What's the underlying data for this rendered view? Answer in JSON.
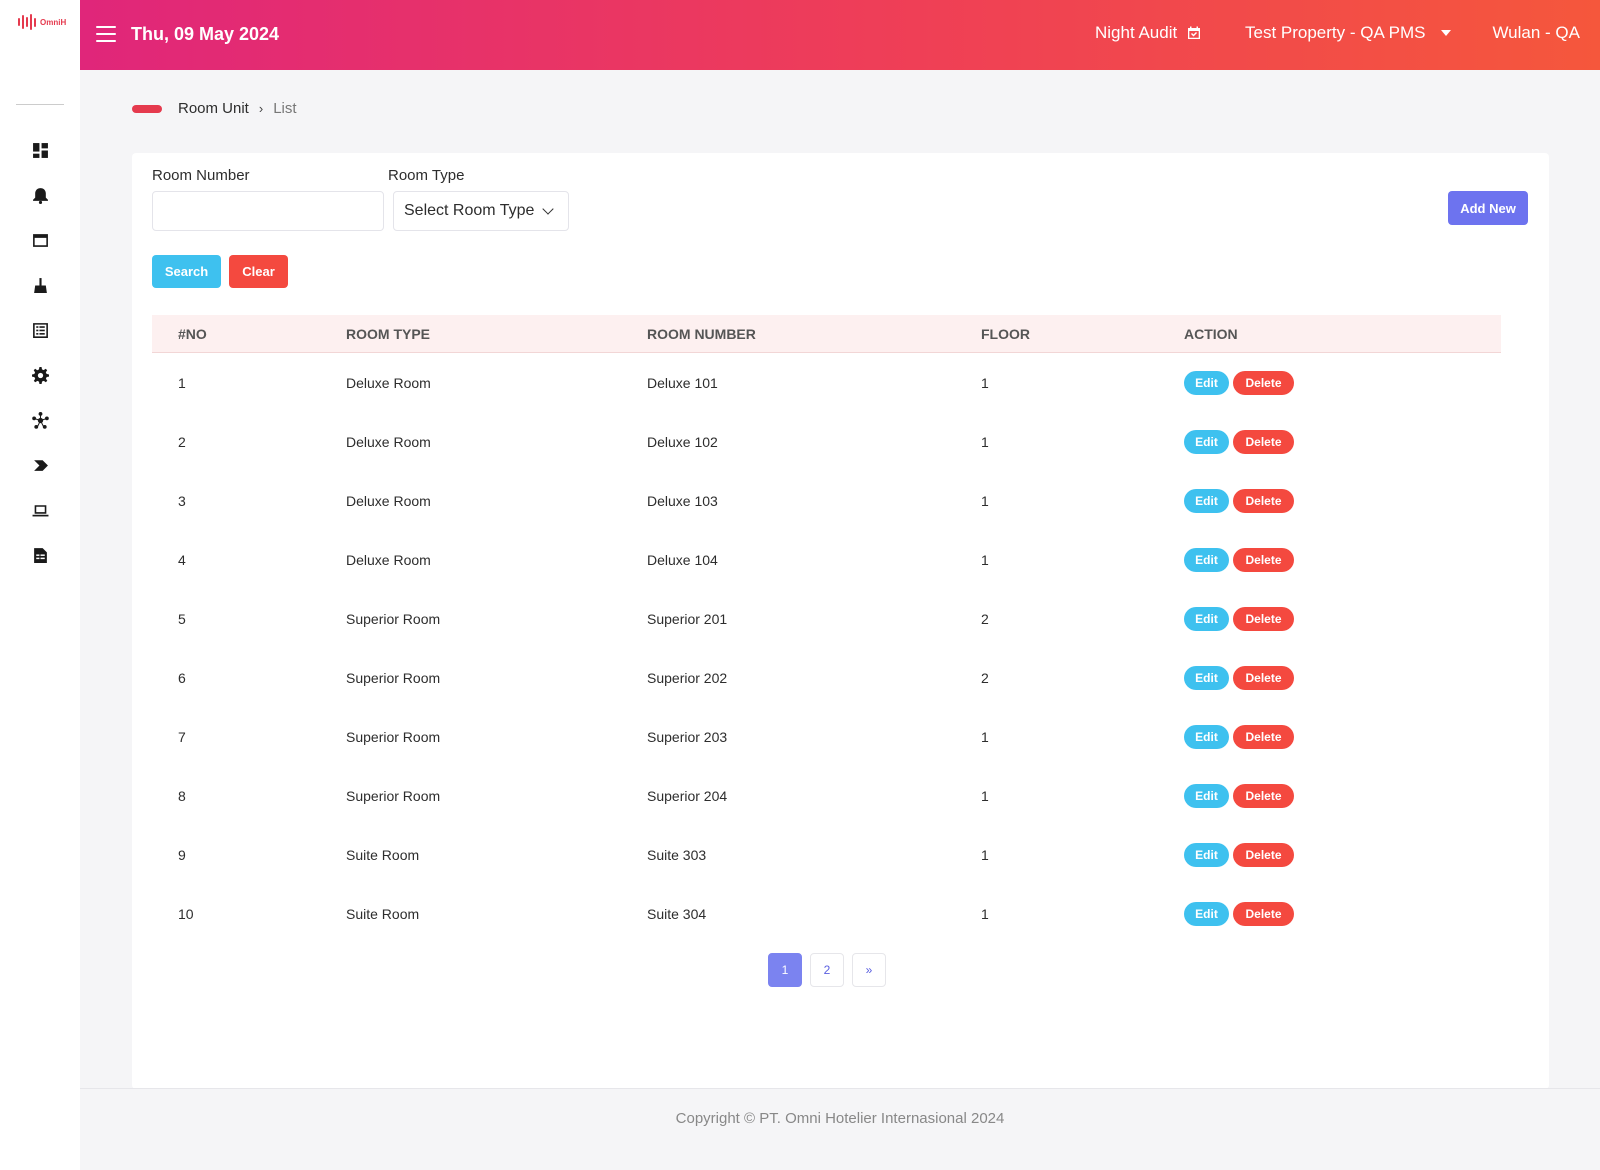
{
  "app": {
    "logo_text": "OmniH",
    "date": "Thu, 09 May 2024",
    "night_audit_label": "Night Audit",
    "property_label": "Test Property - QA PMS",
    "user_label": "Wulan - QA",
    "brand_color": "#e53a4e"
  },
  "sidebar": {
    "icons": [
      "dashboard-icon",
      "bell-icon",
      "window-icon",
      "broom-icon",
      "list-icon",
      "gear-icon",
      "network-icon",
      "tag-icon",
      "laptop-icon",
      "report-icon"
    ]
  },
  "breadcrumb": {
    "parent": "Room Unit",
    "separator": "›",
    "current": "List"
  },
  "filters": {
    "room_number_label": "Room Number",
    "room_number_value": "",
    "room_type_label": "Room Type",
    "room_type_selected": "Select Room Type",
    "add_new_label": "Add New",
    "search_label": "Search",
    "clear_label": "Clear"
  },
  "table": {
    "headers": [
      "#NO",
      "ROOM TYPE",
      "ROOM NUMBER",
      "FLOOR",
      "ACTION"
    ],
    "edit_label": "Edit",
    "delete_label": "Delete",
    "rows": [
      {
        "no": "1",
        "type": "Deluxe Room",
        "number": "Deluxe 101",
        "floor": "1"
      },
      {
        "no": "2",
        "type": "Deluxe Room",
        "number": "Deluxe 102",
        "floor": "1"
      },
      {
        "no": "3",
        "type": "Deluxe Room",
        "number": "Deluxe 103",
        "floor": "1"
      },
      {
        "no": "4",
        "type": "Deluxe Room",
        "number": "Deluxe 104",
        "floor": "1"
      },
      {
        "no": "5",
        "type": "Superior Room",
        "number": "Superior 201",
        "floor": "2"
      },
      {
        "no": "6",
        "type": "Superior Room",
        "number": "Superior 202",
        "floor": "2"
      },
      {
        "no": "7",
        "type": "Superior Room",
        "number": "Superior 203",
        "floor": "1"
      },
      {
        "no": "8",
        "type": "Superior Room",
        "number": "Superior 204",
        "floor": "1"
      },
      {
        "no": "9",
        "type": "Suite Room",
        "number": "Suite 303",
        "floor": "1"
      },
      {
        "no": "10",
        "type": "Suite Room",
        "number": "Suite 304",
        "floor": "1"
      }
    ]
  },
  "pagination": {
    "pages": [
      "1",
      "2"
    ],
    "active": "1",
    "next_label": "»"
  },
  "footer": {
    "copyright": "Copyright © PT. Omni Hotelier Internasional 2024"
  }
}
